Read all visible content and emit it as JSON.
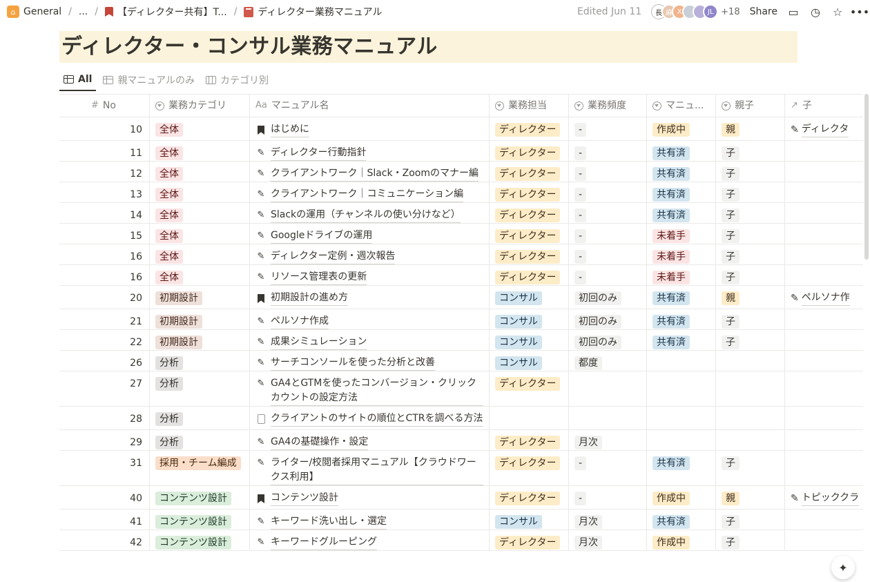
{
  "breadcrumb": {
    "workspace": "General",
    "ellipsis": "...",
    "parent": "【ディレクター共有】T...",
    "current": "ディレクター業務マニュアル"
  },
  "header": {
    "edited": "Edited Jun 11",
    "avatar_initials": [
      "長",
      "麻",
      "X",
      "",
      "",
      "JL"
    ],
    "more_count": "+18",
    "share": "Share"
  },
  "page": {
    "title": "ディレクター・コンサル業務マニュアル"
  },
  "tabs": [
    {
      "label": "All"
    },
    {
      "label": "親マニュアルのみ"
    },
    {
      "label": "カテゴリ別"
    }
  ],
  "columns": {
    "no": "No",
    "category": "業務カテゴリ",
    "name": "マニュアル名",
    "owner": "業務担当",
    "frequency": "業務頻度",
    "status": "マニュ...",
    "parent_child": "親子",
    "child": "子"
  },
  "icons": {
    "name_col": "Aa",
    "no_col": "#",
    "child_col": "↗"
  },
  "colors": {
    "title_bg": "#fbf3db",
    "tag_red": "#fbe4e4",
    "tag_brown": "#eee0da",
    "tag_gray": "#e3e2e0",
    "tag_orange": "#fadec9",
    "tag_green": "#dbeddb",
    "tag_yellow": "#fdecc8",
    "tag_blue": "#d3e5ef"
  },
  "rows": [
    {
      "no": "10",
      "category": "全体",
      "cat_color": "red",
      "icon": "bookmark",
      "name": "はじめに",
      "owner": "ディレクター",
      "owner_color": "yellow",
      "freq": "-",
      "status": "作成中",
      "status_color": "yellow",
      "pc": "親",
      "pc_color": "yellow",
      "child": "ディレクタ"
    },
    {
      "no": "11",
      "category": "全体",
      "cat_color": "red",
      "icon": "edit",
      "name": "ディレクター行動指針",
      "owner": "ディレクター",
      "owner_color": "yellow",
      "freq": "-",
      "status": "共有済",
      "status_color": "blue",
      "pc": "子",
      "pc_color": "lgray",
      "child": ""
    },
    {
      "no": "12",
      "category": "全体",
      "cat_color": "red",
      "icon": "edit",
      "name": "クライアントワーク｜Slack・Zoomのマナー編",
      "owner": "ディレクター",
      "owner_color": "yellow",
      "freq": "-",
      "status": "共有済",
      "status_color": "blue",
      "pc": "子",
      "pc_color": "lgray",
      "child": ""
    },
    {
      "no": "13",
      "category": "全体",
      "cat_color": "red",
      "icon": "edit",
      "name": "クライアントワーク｜コミュニケーション編",
      "owner": "ディレクター",
      "owner_color": "yellow",
      "freq": "-",
      "status": "共有済",
      "status_color": "blue",
      "pc": "子",
      "pc_color": "lgray",
      "child": ""
    },
    {
      "no": "14",
      "category": "全体",
      "cat_color": "red",
      "icon": "edit",
      "name": "Slackの運用（チャンネルの使い分けなど）",
      "owner": "ディレクター",
      "owner_color": "yellow",
      "freq": "-",
      "status": "共有済",
      "status_color": "blue",
      "pc": "子",
      "pc_color": "lgray",
      "child": ""
    },
    {
      "no": "15",
      "category": "全体",
      "cat_color": "red",
      "icon": "edit",
      "name": "Googleドライブの運用",
      "owner": "ディレクター",
      "owner_color": "yellow",
      "freq": "-",
      "status": "未着手",
      "status_color": "red",
      "pc": "子",
      "pc_color": "lgray",
      "child": ""
    },
    {
      "no": "16",
      "category": "全体",
      "cat_color": "red",
      "icon": "edit",
      "name": "ディレクター定例・週次報告",
      "owner": "ディレクター",
      "owner_color": "yellow",
      "freq": "-",
      "status": "未着手",
      "status_color": "red",
      "pc": "子",
      "pc_color": "lgray",
      "child": ""
    },
    {
      "no": "16",
      "category": "全体",
      "cat_color": "red",
      "icon": "edit",
      "name": "リソース管理表の更新",
      "owner": "ディレクター",
      "owner_color": "yellow",
      "freq": "-",
      "status": "未着手",
      "status_color": "red",
      "pc": "子",
      "pc_color": "lgray",
      "child": ""
    },
    {
      "no": "20",
      "category": "初期設計",
      "cat_color": "brown",
      "icon": "bookmark",
      "name": "初期設計の進め方",
      "owner": "コンサル",
      "owner_color": "blue",
      "freq": "初回のみ",
      "status": "共有済",
      "status_color": "blue",
      "pc": "親",
      "pc_color": "yellow",
      "child": "ペルソナ作"
    },
    {
      "no": "21",
      "category": "初期設計",
      "cat_color": "brown",
      "icon": "edit",
      "name": "ペルソナ作成",
      "owner": "コンサル",
      "owner_color": "blue",
      "freq": "初回のみ",
      "status": "共有済",
      "status_color": "blue",
      "pc": "子",
      "pc_color": "lgray",
      "child": ""
    },
    {
      "no": "22",
      "category": "初期設計",
      "cat_color": "brown",
      "icon": "edit",
      "name": "成果シミュレーション",
      "owner": "コンサル",
      "owner_color": "blue",
      "freq": "初回のみ",
      "status": "共有済",
      "status_color": "blue",
      "pc": "子",
      "pc_color": "lgray",
      "child": ""
    },
    {
      "no": "26",
      "category": "分析",
      "cat_color": "gray",
      "icon": "edit",
      "name": "サーチコンソールを使った分析と改善",
      "owner": "コンサル",
      "owner_color": "blue",
      "freq": "都度",
      "status": "",
      "status_color": "",
      "pc": "",
      "pc_color": "",
      "child": ""
    },
    {
      "no": "27",
      "category": "分析",
      "cat_color": "gray",
      "icon": "edit",
      "name": "GA4とGTMを使ったコンバージョン・クリックカウントの設定方法",
      "owner": "ディレクター",
      "owner_color": "yellow",
      "freq": "",
      "status": "",
      "status_color": "",
      "pc": "",
      "pc_color": "",
      "child": ""
    },
    {
      "no": "28",
      "category": "分析",
      "cat_color": "gray",
      "icon": "doc",
      "name": "クライアントのサイトの順位とCTRを調べる方法",
      "owner": "",
      "owner_color": "",
      "freq": "",
      "status": "",
      "status_color": "",
      "pc": "",
      "pc_color": "",
      "child": ""
    },
    {
      "no": "29",
      "category": "分析",
      "cat_color": "gray",
      "icon": "edit",
      "name": "GA4の基礎操作・設定",
      "owner": "ディレクター",
      "owner_color": "yellow",
      "freq": "月次",
      "status": "",
      "status_color": "",
      "pc": "",
      "pc_color": "",
      "child": ""
    },
    {
      "no": "31",
      "category": "採用・チーム編成",
      "cat_color": "orange",
      "icon": "edit",
      "name": "ライター/校閲者採用マニュアル【クラウドワークス利用】",
      "owner": "ディレクター",
      "owner_color": "yellow",
      "freq": "-",
      "status": "共有済",
      "status_color": "blue",
      "pc": "子",
      "pc_color": "lgray",
      "child": ""
    },
    {
      "no": "40",
      "category": "コンテンツ設計",
      "cat_color": "green",
      "icon": "bookmark",
      "name": "コンテンツ設計",
      "owner": "ディレクター",
      "owner_color": "yellow",
      "freq": "-",
      "status": "作成中",
      "status_color": "yellow",
      "pc": "親",
      "pc_color": "yellow",
      "child": "トピッククラ"
    },
    {
      "no": "41",
      "category": "コンテンツ設計",
      "cat_color": "green",
      "icon": "edit",
      "name": "キーワード洗い出し・選定",
      "owner": "コンサル",
      "owner_color": "blue",
      "freq": "月次",
      "status": "共有済",
      "status_color": "blue",
      "pc": "子",
      "pc_color": "lgray",
      "child": ""
    },
    {
      "no": "42",
      "category": "コンテンツ設計",
      "cat_color": "green",
      "icon": "edit",
      "name": "キーワードグルーピング",
      "owner": "ディレクター",
      "owner_color": "yellow",
      "freq": "月次",
      "status": "作成中",
      "status_color": "yellow",
      "pc": "子",
      "pc_color": "lgray",
      "child": ""
    }
  ]
}
